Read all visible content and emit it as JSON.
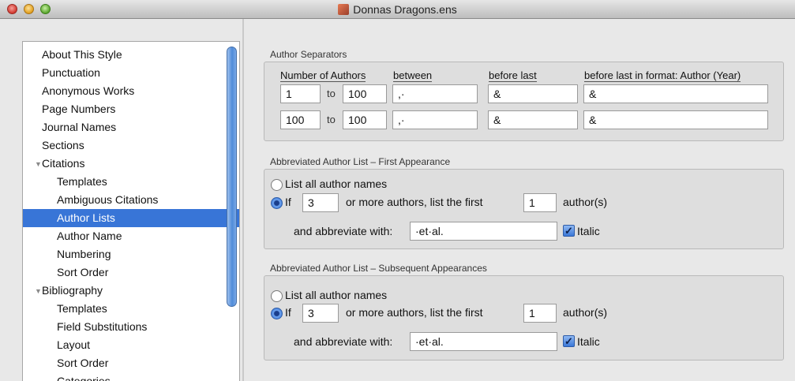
{
  "window": {
    "title": "Donnas Dragons.ens"
  },
  "sidebar": {
    "items": [
      {
        "label": "About This Style"
      },
      {
        "label": "Punctuation"
      },
      {
        "label": "Anonymous Works"
      },
      {
        "label": "Page Numbers"
      },
      {
        "label": "Journal Names"
      },
      {
        "label": "Sections"
      },
      {
        "label": "Citations",
        "expanded": true
      },
      {
        "label": "Templates"
      },
      {
        "label": "Ambiguous Citations"
      },
      {
        "label": "Author Lists",
        "selected": true
      },
      {
        "label": "Author Name"
      },
      {
        "label": "Numbering"
      },
      {
        "label": "Sort Order"
      },
      {
        "label": "Bibliography",
        "expanded": true
      },
      {
        "label": "Templates"
      },
      {
        "label": "Field Substitutions"
      },
      {
        "label": "Layout"
      },
      {
        "label": "Sort Order"
      },
      {
        "label": "Categories"
      }
    ]
  },
  "separators": {
    "title": "Author Separators",
    "headers": {
      "num": "Number of Authors",
      "between": "between",
      "before_last": "before last",
      "before_last_format": "before last in format: Author (Year)"
    },
    "to_label": "to",
    "rows": [
      {
        "from": "1",
        "to": "100",
        "between": ",·",
        "before_last": "&",
        "before_last_format": "&"
      },
      {
        "from": "100",
        "to": "100",
        "between": ",·",
        "before_last": "&",
        "before_last_format": "&"
      }
    ]
  },
  "first": {
    "title": "Abbreviated Author List – First Appearance",
    "list_all": "List all author names",
    "if_label": "If",
    "count": "3",
    "mid_label": "or more authors, list the first",
    "first_n": "1",
    "suffix": "author(s)",
    "abbrev_label": "and abbreviate with:",
    "abbrev_value": "·et·al.",
    "italic_label": "Italic",
    "selected": "if",
    "italic": true
  },
  "subsequent": {
    "title": "Abbreviated Author List – Subsequent Appearances",
    "list_all": "List all author names",
    "if_label": "If",
    "count": "3",
    "mid_label": "or more authors, list the first",
    "first_n": "1",
    "suffix": "author(s)",
    "abbrev_label": "and abbreviate with:",
    "abbrev_value": "·et·al.",
    "italic_label": "Italic",
    "selected": "if",
    "italic": true
  }
}
